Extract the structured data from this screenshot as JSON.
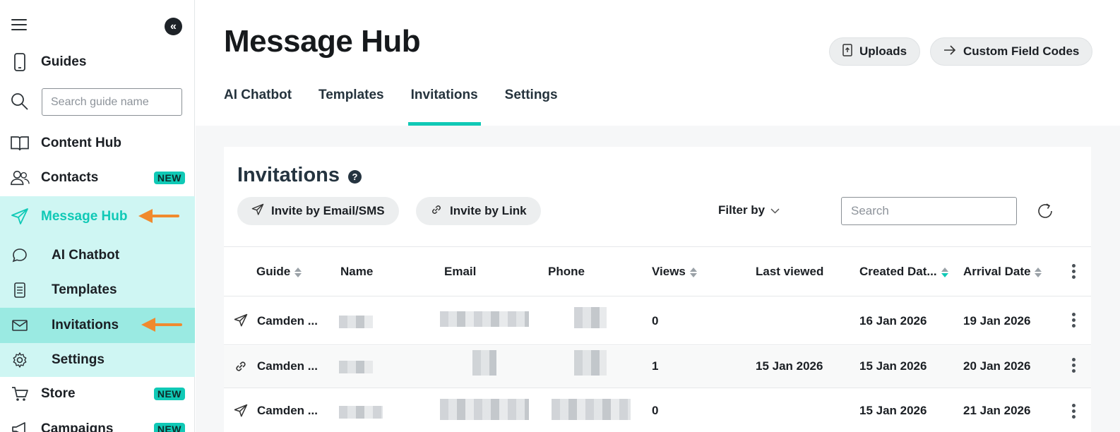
{
  "sidebar": {
    "search_placeholder": "Search guide name",
    "items": {
      "guides": "Guides",
      "content_hub": "Content Hub",
      "contacts": "Contacts",
      "message_hub": "Message Hub",
      "ai_chatbot": "AI Chatbot",
      "templates": "Templates",
      "invitations": "Invitations",
      "settings": "Settings",
      "store": "Store",
      "campaigns": "Campaigns"
    },
    "badge_new": "NEW"
  },
  "header": {
    "title": "Message Hub",
    "uploads_label": "Uploads",
    "custom_field_codes_label": "Custom Field Codes",
    "tabs": [
      "AI Chatbot",
      "Templates",
      "Invitations",
      "Settings"
    ]
  },
  "invitations": {
    "title": "Invitations",
    "help": "?",
    "invite_email_label": "Invite by Email/SMS",
    "invite_link_label": "Invite by Link",
    "filter_label": "Filter by",
    "search_placeholder": "Search",
    "columns": {
      "guide": "Guide",
      "name": "Name",
      "email": "Email",
      "phone": "Phone",
      "views": "Views",
      "last_viewed": "Last viewed",
      "created": "Created Dat...",
      "arrival": "Arrival Date"
    },
    "rows": [
      {
        "type": "email",
        "guide": "Camden ...",
        "views": "0",
        "last_viewed": "",
        "created": "16 Jan 2026",
        "arrival": "19 Jan 2026"
      },
      {
        "type": "link",
        "guide": "Camden ...",
        "views": "1",
        "last_viewed": "15 Jan 2026",
        "created": "15 Jan 2026",
        "arrival": "20 Jan 2026"
      },
      {
        "type": "email",
        "guide": "Camden ...",
        "views": "0",
        "last_viewed": "",
        "created": "15 Jan 2026",
        "arrival": "21 Jan 2026"
      }
    ]
  },
  "colors": {
    "accent": "#10c9b6",
    "hub_band": "#cff6f3",
    "active_band": "#9aeae2",
    "annotation_arrow": "#f08a2e"
  }
}
